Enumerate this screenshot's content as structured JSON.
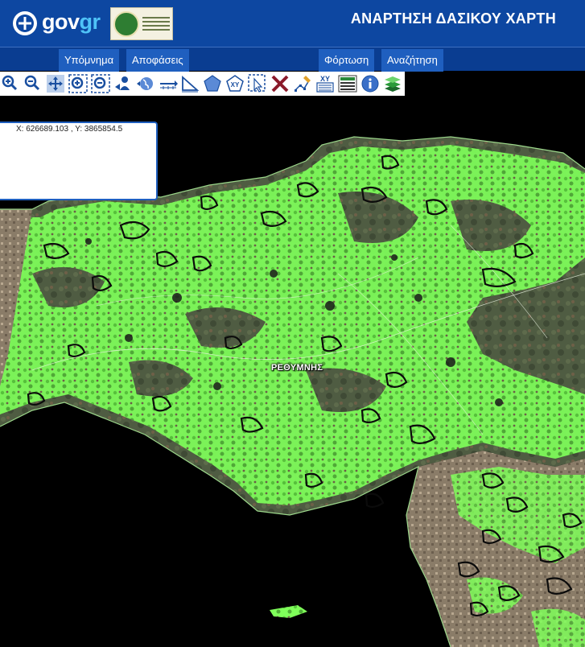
{
  "header": {
    "brand_prefix": "gov",
    "brand_suffix": "gr",
    "title": "ΑΝΑΡΤΗΣΗ ΔΑΣΙΚΟΥ ΧΑΡΤΗ"
  },
  "nav": {
    "legend": "Υπόμνημα",
    "decisions": "Αποφάσεις",
    "upload": "Φόρτωση",
    "search": "Αναζήτηση"
  },
  "toolbar": {
    "tools": [
      {
        "icon": "zoom-in-icon"
      },
      {
        "icon": "zoom-out-icon"
      },
      {
        "icon": "pan-icon"
      },
      {
        "icon": "zoom-box-in-icon"
      },
      {
        "icon": "zoom-box-out-icon"
      },
      {
        "icon": "previous-extent-icon"
      },
      {
        "icon": "full-extent-icon"
      },
      {
        "icon": "measure-distance-icon"
      },
      {
        "icon": "measure-angle-icon"
      },
      {
        "icon": "measure-area-icon"
      },
      {
        "icon": "xy-pentagon-icon"
      },
      {
        "icon": "select-icon"
      },
      {
        "icon": "clear-icon"
      },
      {
        "icon": "edit-vertices-icon"
      },
      {
        "icon": "xy-coordinates-icon"
      },
      {
        "icon": "legend-icon"
      },
      {
        "icon": "info-icon"
      },
      {
        "icon": "layers-icon"
      }
    ]
  },
  "coordinates": {
    "text": "X: 626689.103 , Y: 3865854.5"
  },
  "map": {
    "place_label": "ΡΕΘΥΜΝΗΣ",
    "colors": {
      "background": "#000000",
      "forest_fill": "#7fff5a",
      "terrain": "#4a5a3a",
      "outline": "#0b0b0b"
    }
  }
}
